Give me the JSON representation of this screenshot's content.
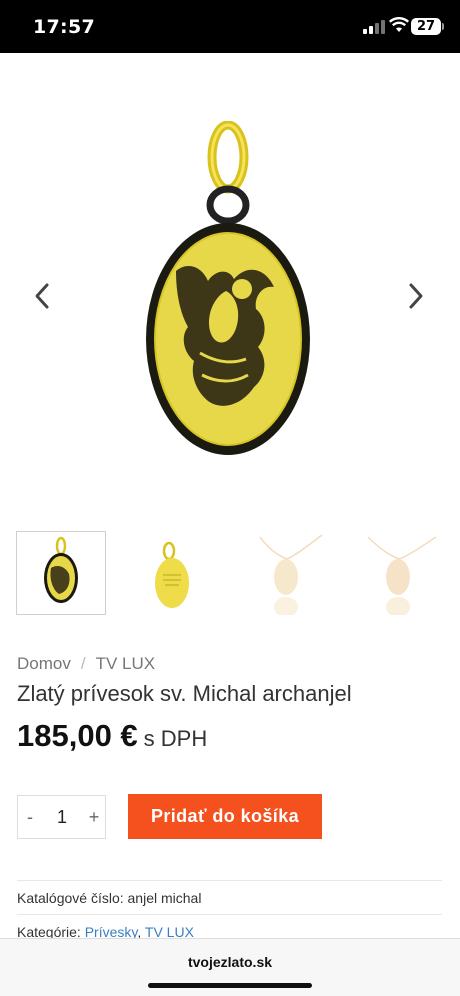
{
  "status_bar": {
    "time": "17:57",
    "battery": "27"
  },
  "gallery": {
    "thumbnails": [
      {
        "name": "thumb-front"
      },
      {
        "name": "thumb-back"
      },
      {
        "name": "thumb-chain-1"
      },
      {
        "name": "thumb-chain-2"
      }
    ]
  },
  "breadcrumb": {
    "home": "Domov",
    "separator": "/",
    "category": "TV LUX"
  },
  "product": {
    "title": "Zlatý prívesok sv. Michal archanjel",
    "price": "185,00 €",
    "price_suffix": "s DPH"
  },
  "cart": {
    "minus": "-",
    "quantity": "1",
    "plus": "+",
    "add_label": "Pridať do košíka"
  },
  "meta": {
    "catalog_label": "Katalógové číslo:",
    "catalog_value": "anjel michal",
    "categories_label": "Kategórie:",
    "category_1": "Prívesky",
    "category_sep": ",",
    "category_2": "TV LUX"
  },
  "browser": {
    "url": "tvojezlato.sk"
  },
  "colors": {
    "accent": "#f4511e",
    "link": "#3a7fc1",
    "gold": "#e7d23a"
  }
}
